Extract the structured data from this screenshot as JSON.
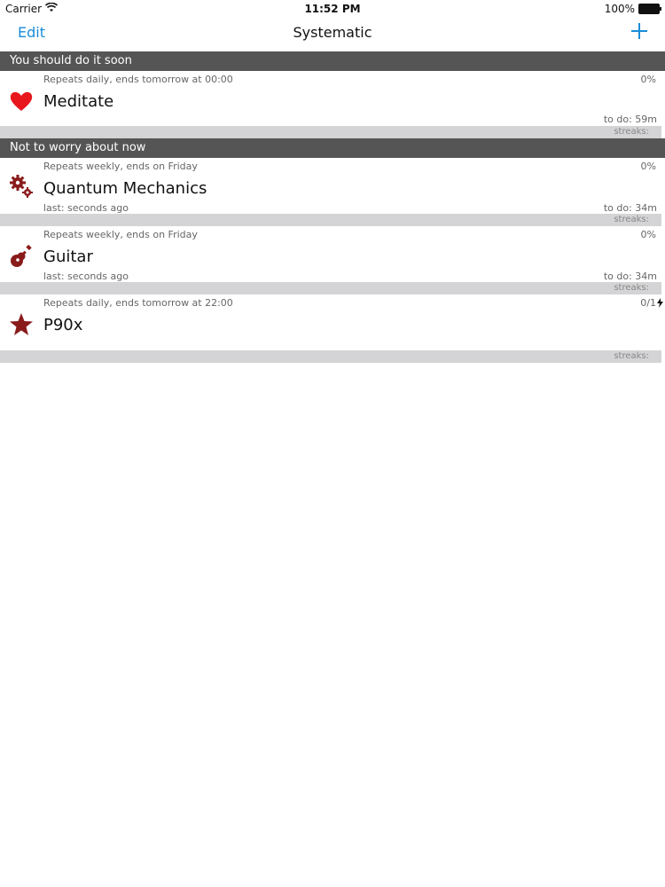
{
  "status_bar": {
    "carrier": "Carrier",
    "time": "11:52 PM",
    "battery": "100%"
  },
  "navbar": {
    "edit_label": "Edit",
    "title": "Systematic"
  },
  "sections": [
    {
      "header": "You should do it soon",
      "items": [
        {
          "icon": "heart-icon",
          "icon_color": "#e8161d",
          "repeat": "Repeats daily, ends tomorrow at 00:00",
          "progress": "0%",
          "name": "Meditate",
          "last": "",
          "todo": "to do: 59m",
          "streaks": "streaks:"
        }
      ]
    },
    {
      "header": "Not to worry about now",
      "items": [
        {
          "icon": "gears-icon",
          "icon_color": "#8a1b1b",
          "repeat": "Repeats weekly, ends on Friday",
          "progress": "0%",
          "name": "Quantum Mechanics",
          "last": "last: seconds ago",
          "todo": "to do: 34m",
          "streaks": "streaks:"
        },
        {
          "icon": "guitar-icon",
          "icon_color": "#8a1b1b",
          "repeat": "Repeats weekly, ends on Friday",
          "progress": "0%",
          "name": "Guitar",
          "last": "last: seconds ago",
          "todo": "to do: 34m",
          "streaks": "streaks:"
        },
        {
          "icon": "star-icon",
          "icon_color": "#8a1b1b",
          "repeat": "Repeats daily, ends tomorrow at 22:00",
          "progress": "0/1",
          "progress_icon": "lightning-icon",
          "name": "P90x",
          "last": "",
          "todo": "",
          "streaks": "streaks:"
        }
      ]
    }
  ]
}
